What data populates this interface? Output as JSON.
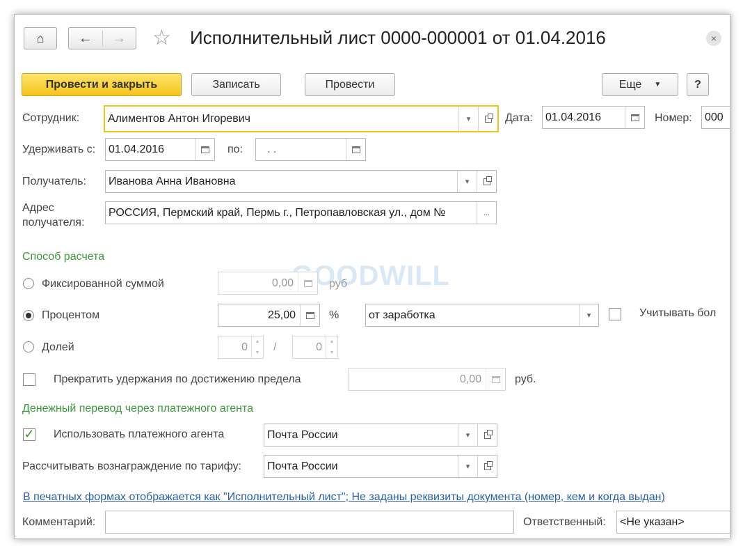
{
  "window": {
    "title": "Исполнительный лист 0000-000001 от 01.04.2016",
    "close": "×"
  },
  "nav": {
    "home": "⌂",
    "back": "←",
    "forward": "→",
    "favorite": "☆"
  },
  "toolbar": {
    "post_close": "Провести и закрыть",
    "save": "Записать",
    "post": "Провести",
    "more": "Еще",
    "help": "?"
  },
  "form": {
    "employee_label": "Сотрудник:",
    "employee_value": "Алиментов Антон Игоревич",
    "date_label": "Дата:",
    "date_value": "01.04.2016",
    "number_label": "Номер:",
    "number_value": "000",
    "withhold_from_label": "Удерживать с:",
    "withhold_from_value": "01.04.2016",
    "withhold_to_label": "по:",
    "withhold_to_value": " .  .",
    "recipient_label": "Получатель:",
    "recipient_value": "Иванова Анна Ивановна",
    "address_label_1": "Адрес",
    "address_label_2": "получателя:",
    "address_value": "РОССИЯ, Пермский край, Пермь г., Петропавловская ул., дом №",
    "address_btn": "..."
  },
  "calc": {
    "section": "Способ расчета",
    "fixed_label": "Фиксированной суммой",
    "fixed_value": "0,00",
    "fixed_unit": "руб",
    "percent_label": "Процентом",
    "percent_value": "25,00",
    "percent_unit": "%",
    "percent_base": "от заработка",
    "account_label": "Учитывать бол",
    "share_label": "Долей",
    "share_num": "0",
    "share_sep": "/",
    "share_den": "0",
    "selected": "percent",
    "stop_label": "Прекратить удержания по достижению предела",
    "stop_checked": false,
    "stop_value": "0,00",
    "stop_unit": "руб."
  },
  "transfer": {
    "section": "Денежный перевод через платежного агента",
    "use_agent_label": "Использовать платежного агента",
    "use_agent_checked": true,
    "agent_value": "Почта России",
    "tariff_label": "Рассчитывать вознаграждение по тарифу:",
    "tariff_value": "Почта России"
  },
  "footer": {
    "link": "В печатных формах отображается как \"Исполнительный лист\"; Не заданы реквизиты документа (номер, кем и когда выдан)",
    "comment_label": "Комментарий:",
    "comment_value": "",
    "responsible_label": "Ответственный:",
    "responsible_value": "<Не указан>"
  },
  "watermark": "GOODWILL",
  "colors": {
    "primary_button": "#f5c51c",
    "section": "#3a9a3a",
    "link": "#2c5ea8",
    "focus": "#f0c419"
  }
}
